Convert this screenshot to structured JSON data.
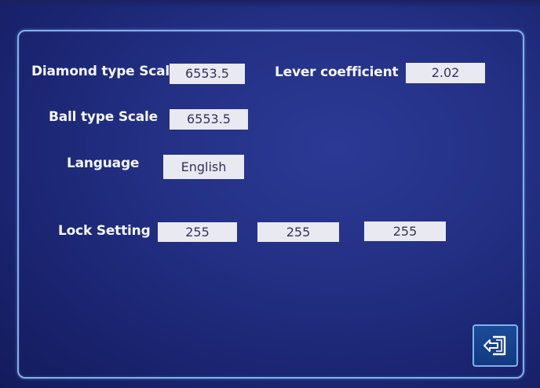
{
  "settings": {
    "diamond_scale_label": "Diamond type Scal",
    "diamond_scale_value": "6553.5",
    "lever_coefficient_label": "Lever coefficient",
    "lever_coefficient_value": "2.02",
    "ball_scale_label": "Ball type Scale",
    "ball_scale_value": "6553.5",
    "language_label": "Language",
    "language_value": "English",
    "lock_setting_label": "Lock Setting",
    "lock_values": [
      "255",
      "255",
      "255"
    ]
  },
  "exit_button": {
    "icon": "exit-icon"
  },
  "colors": {
    "background": "#1f2a7e",
    "panel_border": "#7fb2ec",
    "field_background": "#e9e9f1",
    "field_text": "#33345a",
    "label_text": "#f4f6ff"
  }
}
